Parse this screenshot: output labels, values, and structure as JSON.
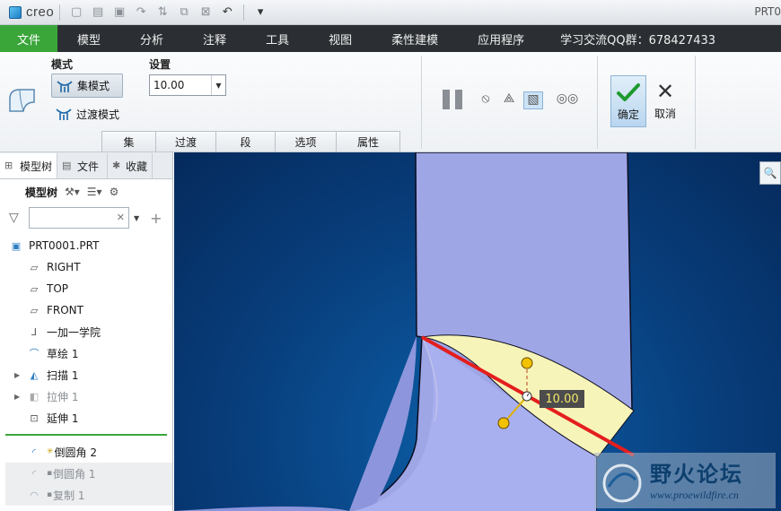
{
  "app": {
    "logo_text": "creo",
    "window_title": "PRT0"
  },
  "menu": [
    {
      "label": "文件"
    },
    {
      "label": "模型"
    },
    {
      "label": "分析"
    },
    {
      "label": "注释"
    },
    {
      "label": "工具"
    },
    {
      "label": "视图"
    },
    {
      "label": "柔性建模"
    },
    {
      "label": "应用程序"
    },
    {
      "label": "学习交流QQ群：678427433"
    }
  ],
  "ribbon": {
    "mode_group_label": "模式",
    "set_mode_label": "集模式",
    "transition_mode_label": "过渡模式",
    "settings_group_label": "设置",
    "radius_value": "10.00",
    "panel_tabs": [
      "集",
      "过渡",
      "段",
      "选项",
      "属性"
    ],
    "ok_label": "确定",
    "cancel_label": "取消"
  },
  "left_panel": {
    "tabs": [
      "模型树",
      "文件",
      "收藏"
    ],
    "toolbar_label": "模型树",
    "filter_placeholder": "",
    "tree": [
      {
        "label": "PRT0001.PRT",
        "icon": "part-icon",
        "expand": false,
        "state": "normal"
      },
      {
        "label": "RIGHT",
        "icon": "datum-plane-icon",
        "expand": false,
        "state": "normal"
      },
      {
        "label": "TOP",
        "icon": "datum-plane-icon",
        "expand": false,
        "state": "normal"
      },
      {
        "label": "FRONT",
        "icon": "datum-plane-icon",
        "expand": false,
        "state": "normal"
      },
      {
        "label": "一加一学院",
        "icon": "coordinate-system-icon",
        "expand": false,
        "state": "normal"
      },
      {
        "label": "草绘 1",
        "icon": "sketch-icon",
        "expand": false,
        "state": "normal"
      },
      {
        "label": "扫描 1",
        "icon": "sweep-icon",
        "expand": true,
        "state": "normal"
      },
      {
        "label": "拉伸 1",
        "icon": "extrude-icon",
        "expand": true,
        "state": "dim"
      },
      {
        "label": "延伸 1",
        "icon": "extend-icon",
        "expand": false,
        "state": "normal"
      }
    ],
    "tree_after": [
      {
        "label": "倒圆角 2",
        "marker": "✳",
        "icon": "round-icon",
        "state": "normal"
      },
      {
        "label": "倒圆角 1",
        "marker": "▪",
        "icon": "round-icon",
        "state": "dim"
      },
      {
        "label": "复制 1",
        "marker": "▪",
        "icon": "copy-icon",
        "state": "dim"
      }
    ]
  },
  "viewport": {
    "dimension_label": "10.00",
    "watermark_title": "野火论坛",
    "watermark_url": "www.proewildfire.cn"
  }
}
